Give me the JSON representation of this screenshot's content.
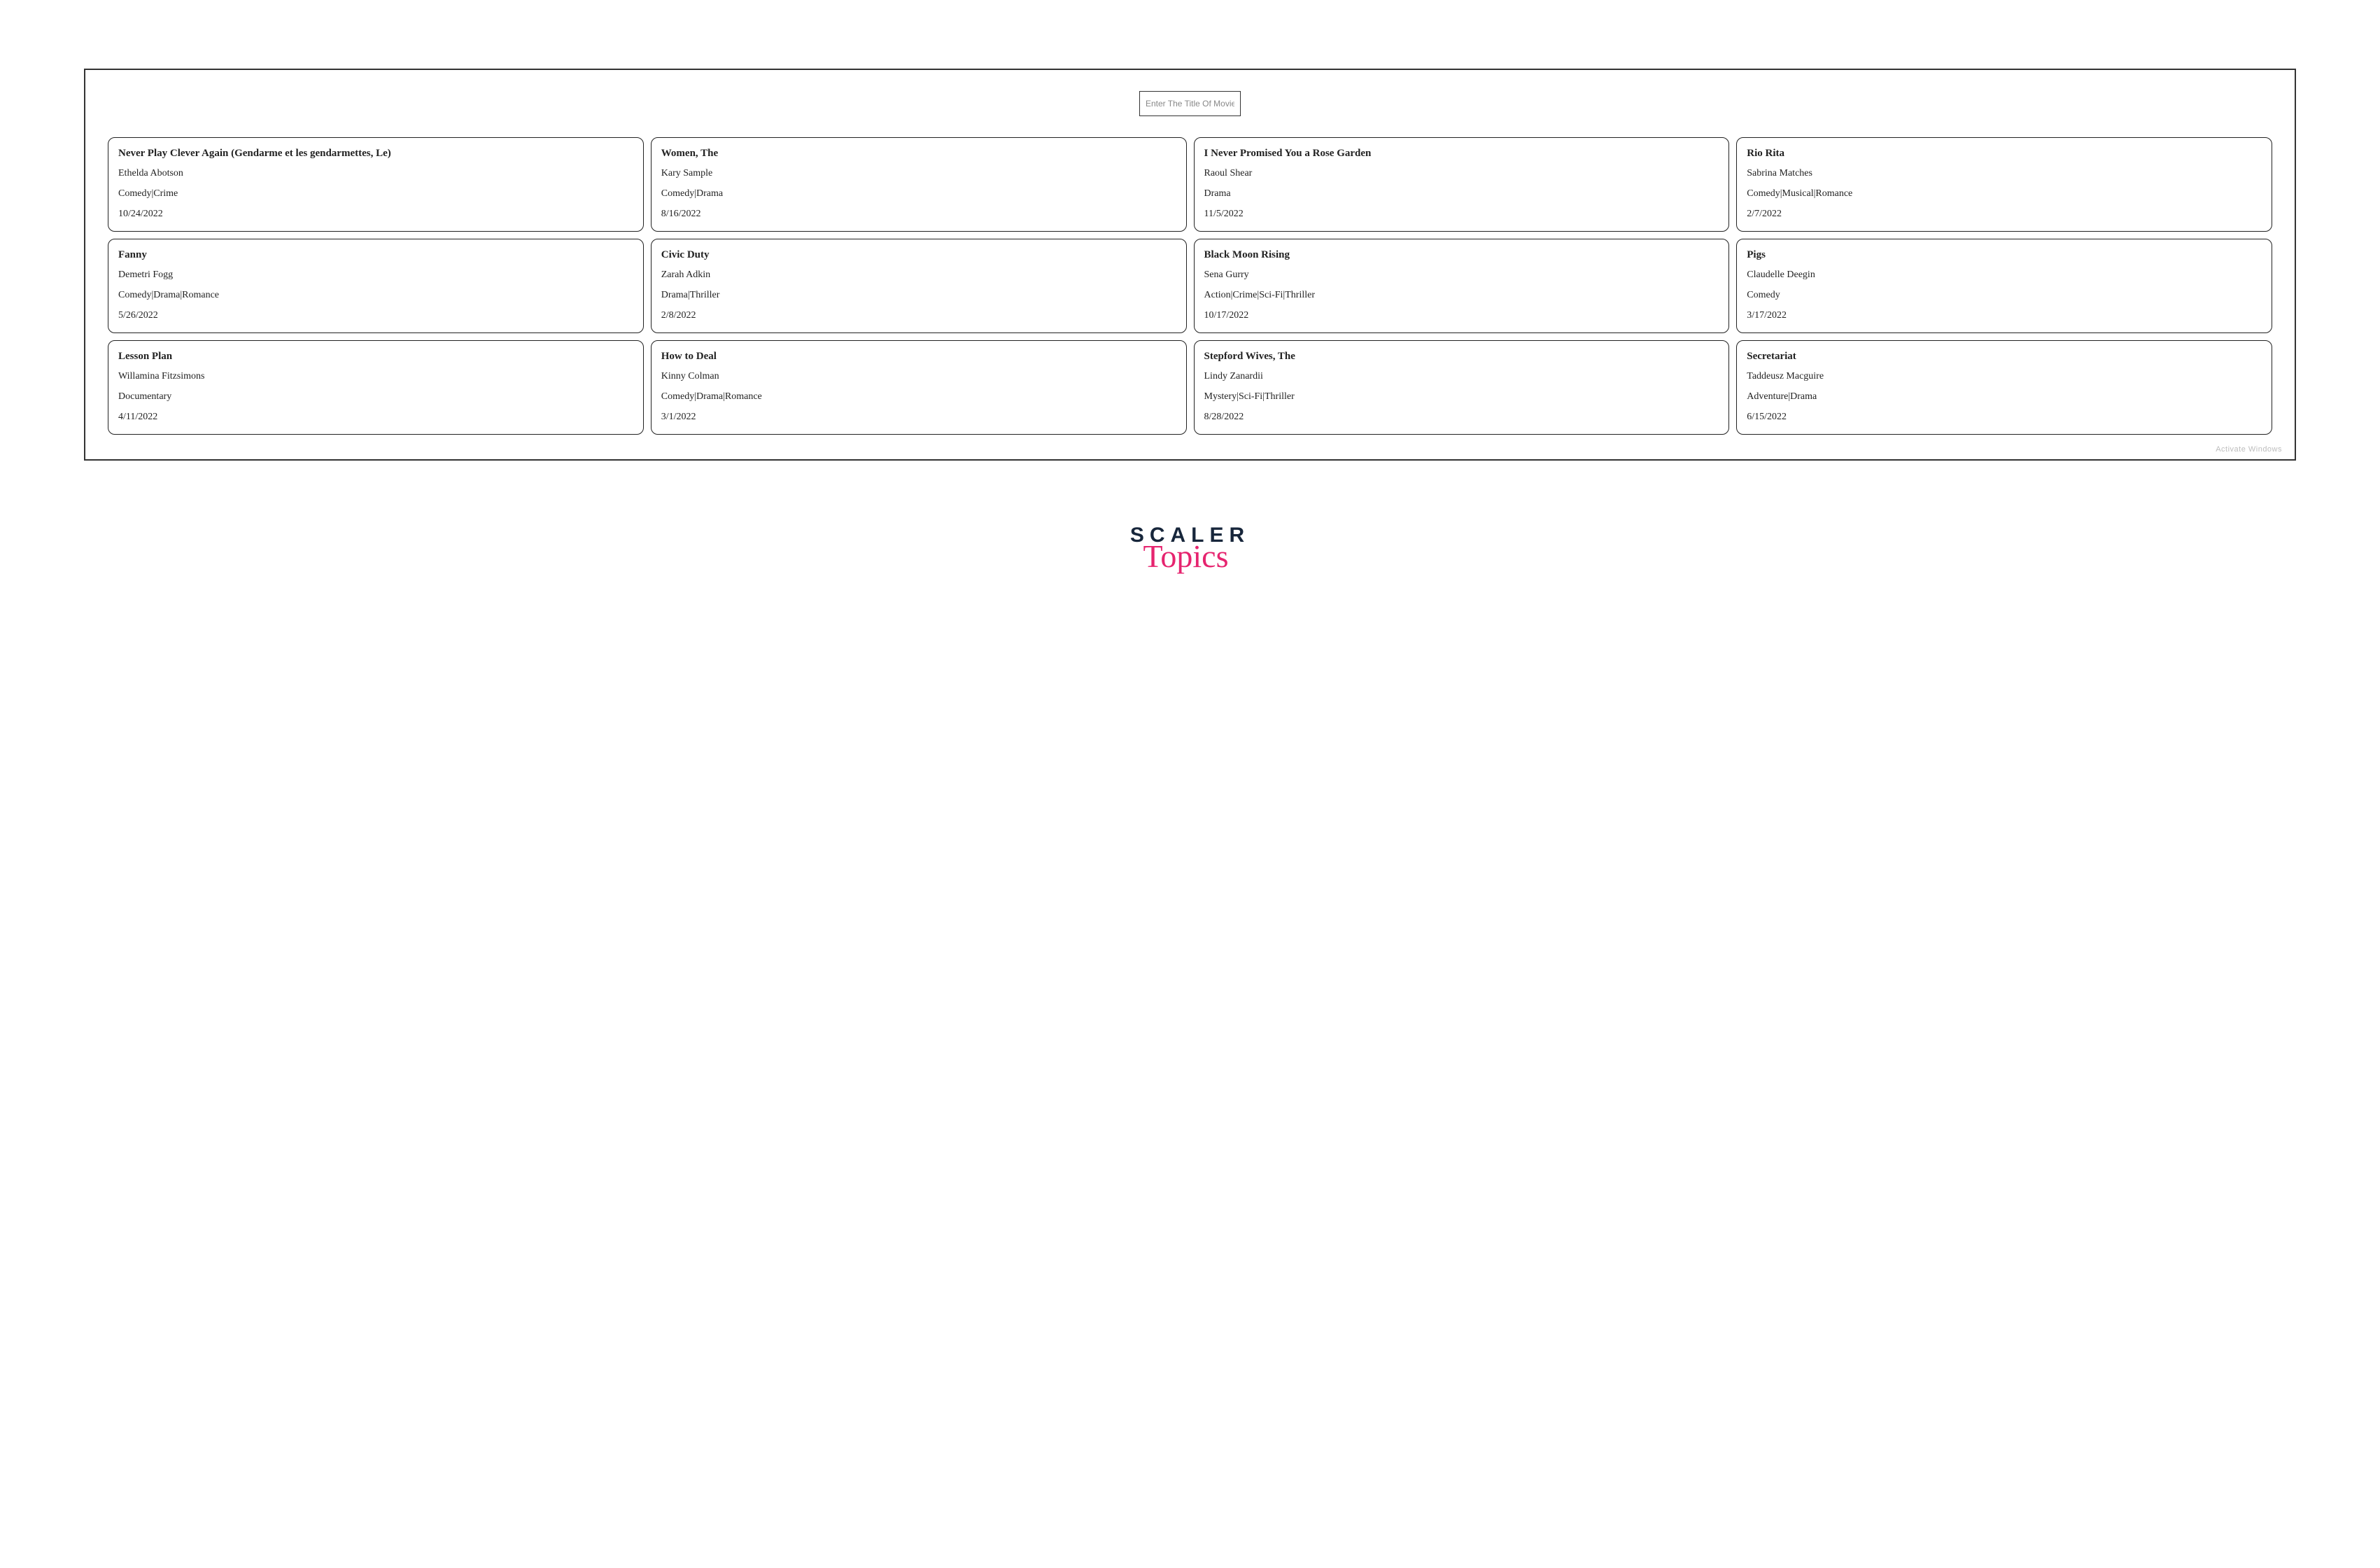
{
  "search": {
    "placeholder": "Enter The Title Of Movie",
    "value": ""
  },
  "cards": [
    {
      "title": "Never Play Clever Again (Gendarme et les gendarmettes, Le)",
      "author": "Ethelda Abotson",
      "genre": "Comedy|Crime",
      "date": "10/24/2022"
    },
    {
      "title": "Women, The",
      "author": "Kary Sample",
      "genre": "Comedy|Drama",
      "date": "8/16/2022"
    },
    {
      "title": "I Never Promised You a Rose Garden",
      "author": "Raoul Shear",
      "genre": "Drama",
      "date": "11/5/2022"
    },
    {
      "title": "Rio Rita",
      "author": "Sabrina Matches",
      "genre": "Comedy|Musical|Romance",
      "date": "2/7/2022"
    },
    {
      "title": "Fanny",
      "author": "Demetri Fogg",
      "genre": "Comedy|Drama|Romance",
      "date": "5/26/2022"
    },
    {
      "title": "Civic Duty",
      "author": "Zarah Adkin",
      "genre": "Drama|Thriller",
      "date": "2/8/2022"
    },
    {
      "title": "Black Moon Rising",
      "author": "Sena Gurry",
      "genre": "Action|Crime|Sci-Fi|Thriller",
      "date": "10/17/2022"
    },
    {
      "title": "Pigs",
      "author": "Claudelle Deegin",
      "genre": "Comedy",
      "date": "3/17/2022"
    },
    {
      "title": "Lesson Plan",
      "author": "Willamina Fitzsimons",
      "genre": "Documentary",
      "date": "4/11/2022"
    },
    {
      "title": "How to Deal",
      "author": "Kinny Colman",
      "genre": "Comedy|Drama|Romance",
      "date": "3/1/2022"
    },
    {
      "title": "Stepford Wives, The",
      "author": "Lindy Zanardii",
      "genre": "Mystery|Sci-Fi|Thriller",
      "date": "8/28/2022"
    },
    {
      "title": "Secretariat",
      "author": "Taddeusz Macguire",
      "genre": "Adventure|Drama",
      "date": "6/15/2022"
    }
  ],
  "ghost_footer": "Activate Windows",
  "logo": {
    "line1": "SCALER",
    "line2": "Topics"
  }
}
